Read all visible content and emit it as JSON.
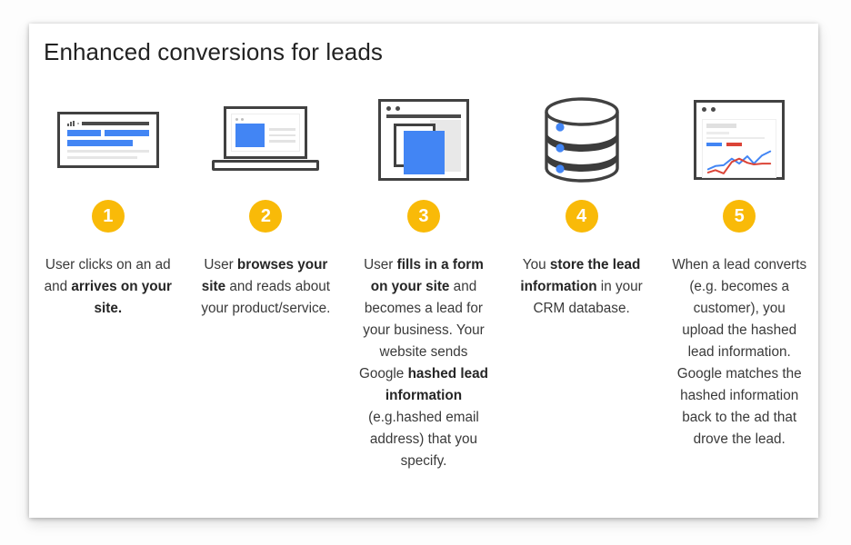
{
  "card": {
    "title": "Enhanced conversions for leads"
  },
  "colors": {
    "badge_background": "#F9BA08",
    "badge_text": "#FFFFFF",
    "accent_blue": "#4285F4",
    "accent_red": "#DB4437",
    "icon_outline": "#414141",
    "body_text": "#3A3A3A",
    "card_background": "#FFFFFF"
  },
  "steps": [
    {
      "number": "1",
      "icon": "ad-result-window-icon",
      "text_parts": [
        {
          "text": "User clicks on an ad and ",
          "bold": false
        },
        {
          "text": "arrives on your site.",
          "bold": true
        }
      ],
      "plain_text": "User clicks on an ad and arrives on your site."
    },
    {
      "number": "2",
      "icon": "laptop-website-icon",
      "text_parts": [
        {
          "text": "User ",
          "bold": false
        },
        {
          "text": "browses your site",
          "bold": true
        },
        {
          "text": " and reads about your product/service.",
          "bold": false
        }
      ],
      "plain_text": "User browses your site and reads about your product/service."
    },
    {
      "number": "3",
      "icon": "browser-form-icon",
      "text_parts": [
        {
          "text": "User ",
          "bold": false
        },
        {
          "text": "fills in a form on your site",
          "bold": true
        },
        {
          "text": " and becomes a lead for your business. Your website sends Google ",
          "bold": false
        },
        {
          "text": "hashed lead information",
          "bold": true
        },
        {
          "text": " (e.g.hashed email address) that you specify.",
          "bold": false
        }
      ],
      "plain_text": "User fills in a form on your site and becomes a lead for your business. Your website sends Google hashed lead information (e.g.hashed email address) that you specify."
    },
    {
      "number": "4",
      "icon": "database-icon",
      "text_parts": [
        {
          "text": "You ",
          "bold": false
        },
        {
          "text": "store the lead information",
          "bold": true
        },
        {
          "text": " in your CRM database.",
          "bold": false
        }
      ],
      "plain_text": "You store the lead information in your CRM database."
    },
    {
      "number": "5",
      "icon": "analytics-dashboard-icon",
      "text_parts": [
        {
          "text": "When a lead converts (e.g. becomes a customer), you upload the hashed lead information. Google matches the hashed information back to the ad that drove the lead.",
          "bold": false
        }
      ],
      "plain_text": "When a lead converts (e.g. becomes a customer), you upload the hashed lead information. Google matches the hashed information back to the ad that drove the lead."
    }
  ]
}
